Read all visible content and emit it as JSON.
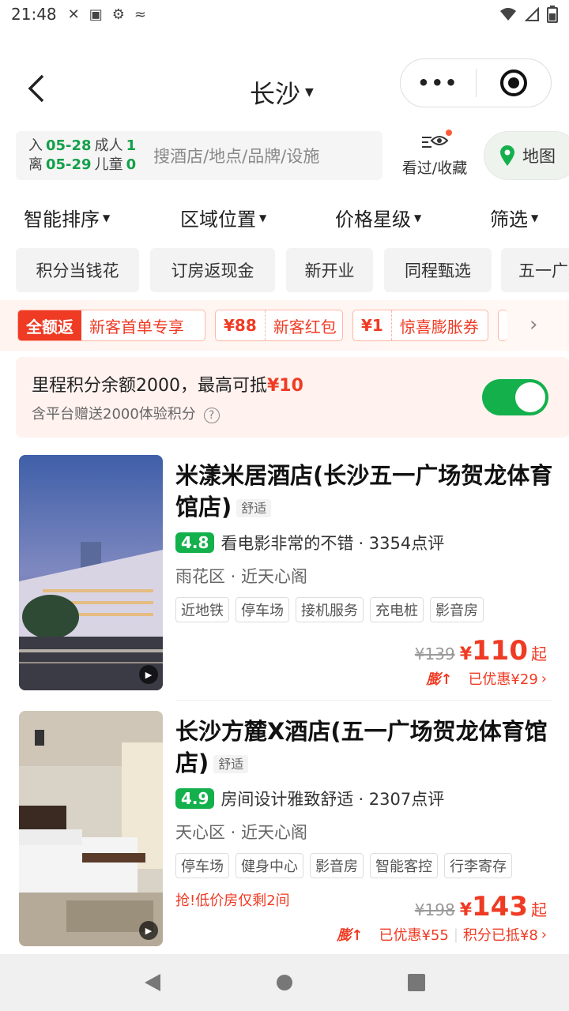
{
  "status_bar": {
    "time": "21:48",
    "icons": [
      "tool-icon",
      "a-icon",
      "gear-icon",
      "tune-icon"
    ],
    "right_icons": [
      "wifi-icon",
      "signal-icon",
      "battery-icon"
    ]
  },
  "nav": {
    "city": "长沙",
    "more_label": "•••"
  },
  "search": {
    "checkin_label": "入",
    "checkin_date": "05-28",
    "checkout_label": "离",
    "checkout_date": "05-29",
    "adult_label": "成人",
    "adult_count": "1",
    "child_label": "儿童",
    "child_count": "0",
    "placeholder": "搜酒店/地点/品牌/设施",
    "fav_label": "看过/收藏",
    "map_label": "地图"
  },
  "sort": [
    "智能排序",
    "区域位置",
    "价格星级",
    "筛选"
  ],
  "quick_filters": [
    "积分当钱花",
    "订房返现金",
    "新开业",
    "同程甄选",
    "五一广场"
  ],
  "promo": {
    "tag1_solid": "全额返",
    "tag1_text": "新客首单专享",
    "tag2_amount": "¥88",
    "tag2_text": "新客红包",
    "tag3_amount": "¥1",
    "tag3_text": "惊喜膨胀券"
  },
  "points": {
    "line1_prefix": "里程积分余额2000，最高可抵",
    "line1_amount": "¥10",
    "line2": "含平台赠送2000体验积分",
    "toggle_on": true
  },
  "hotels": [
    {
      "name": "米漾米居酒店(长沙五一广场贺龙体育馆店)",
      "tier": "舒适",
      "score": "4.8",
      "highlight": "看电影非常的不错",
      "reviews": "· 3354点评",
      "location": "雨花区 · 近天心阁",
      "facilities": [
        "近地铁",
        "停车场",
        "接机服务",
        "充电桩",
        "影音房"
      ],
      "urgent": "",
      "orig_price": "¥139",
      "price_symbol": "¥",
      "price": "110",
      "price_suffix": "起",
      "boost": "膨↑",
      "discount": "已优惠¥29",
      "points_used": ""
    },
    {
      "name": "长沙方麓X酒店(五一广场贺龙体育馆店)",
      "tier": "舒适",
      "score": "4.9",
      "highlight": "房间设计雅致舒适",
      "reviews": "· 2307点评",
      "location": "天心区 · 近天心阁",
      "facilities": [
        "停车场",
        "健身中心",
        "影音房",
        "智能客控",
        "行李寄存"
      ],
      "urgent": "抢!低价房仅剩2间",
      "orig_price": "¥198",
      "price_symbol": "¥",
      "price": "143",
      "price_suffix": "起",
      "boost": "膨↑",
      "discount": "已优惠¥55",
      "points_used": "积分已抵¥8"
    }
  ],
  "colors": {
    "accent_green": "#14b04c",
    "accent_red": "#ef3b24"
  }
}
